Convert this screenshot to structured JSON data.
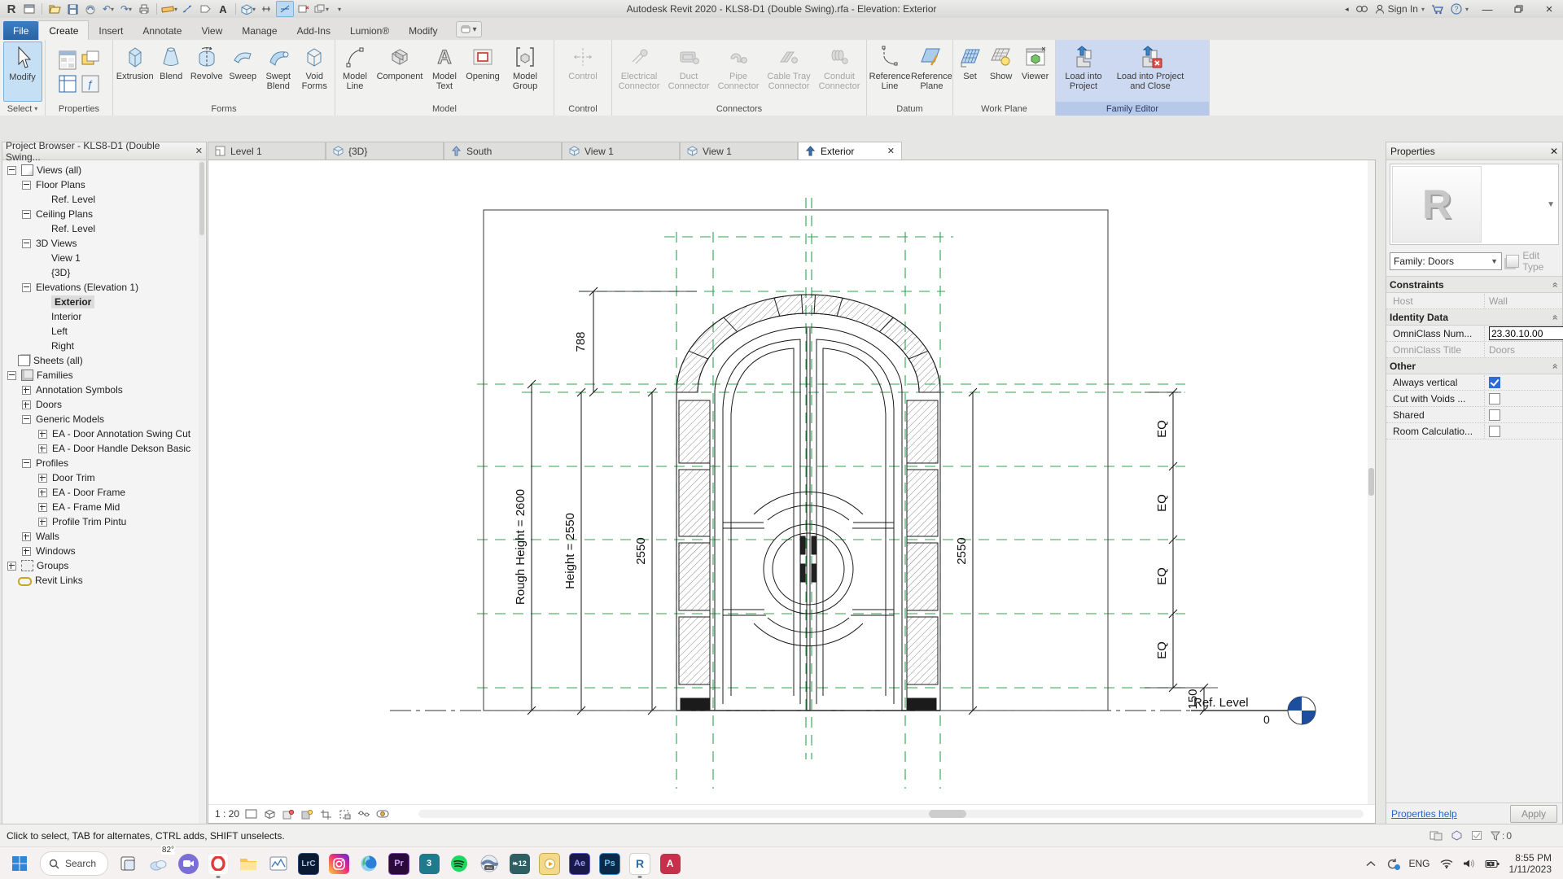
{
  "window": {
    "title": "Autodesk Revit 2020 - KLS8-D1 (Double Swing).rfa - Elevation: Exterior",
    "sign_in": "Sign In"
  },
  "ribbon": {
    "tabs": [
      "File",
      "Create",
      "Insert",
      "Annotate",
      "View",
      "Manage",
      "Add-Ins",
      "Lumion®",
      "Modify"
    ],
    "groups": {
      "select": "Select",
      "properties": "Properties",
      "forms": "Forms",
      "model": "Model",
      "control": "Control",
      "connectors": "Connectors",
      "datum": "Datum",
      "work_plane": "Work Plane",
      "family_editor": "Family Editor"
    },
    "select": {
      "modify": "Modify"
    },
    "forms": {
      "extrusion": "Extrusion",
      "blend": "Blend",
      "revolve": "Revolve",
      "sweep": "Sweep",
      "swept_blend": "Swept Blend",
      "void_forms": "Void Forms"
    },
    "model": {
      "model_line": "Model Line",
      "component": "Component",
      "model_text": "Model Text",
      "opening": "Opening",
      "model_group": "Model Group"
    },
    "control": {
      "control": "Control"
    },
    "connectors": {
      "electrical": "Electrical Connector",
      "duct": "Duct Connector",
      "pipe": "Pipe Connector",
      "cable_tray": "Cable Tray Connector",
      "conduit": "Conduit Connector"
    },
    "datum": {
      "reference_line": "Reference Line",
      "reference_plane": "Reference Plane"
    },
    "work_plane": {
      "set": "Set",
      "show": "Show",
      "viewer": "Viewer"
    },
    "family_editor": {
      "load": "Load into Project",
      "load_close": "Load into Project and Close"
    }
  },
  "browser": {
    "title": "Project Browser - KLS8-D1 (Double Swing...",
    "items": [
      "Views (all)",
      "Floor Plans",
      "Ref. Level",
      "Ceiling Plans",
      "Ref. Level",
      "3D Views",
      "View 1",
      "{3D}",
      "Elevations (Elevation 1)",
      "Exterior",
      "Interior",
      "Left",
      "Right",
      "Sheets (all)",
      "Families",
      "Annotation Symbols",
      "Doors",
      "Generic Models",
      "EA - Door Annotation Swing Cut",
      "EA - Door Handle Dekson Basic",
      "Profiles",
      "Door Trim",
      "EA - Door Frame",
      "EA - Frame Mid",
      "Profile Trim Pintu",
      "Walls",
      "Windows",
      "Groups",
      "Revit Links"
    ]
  },
  "view_tabs": [
    "Level 1",
    "{3D}",
    "South",
    "View 1",
    "View 1",
    "Exterior"
  ],
  "properties_panel": {
    "header": "Properties",
    "type_selector": "Family: Doors",
    "edit_type": "Edit Type",
    "sections": {
      "constraints": "Constraints",
      "identity": "Identity Data",
      "other": "Other"
    },
    "rows": {
      "host_label": "Host",
      "host_value": "Wall",
      "omniclass_num_label": "OmniClass Num...",
      "omniclass_num_value": "23.30.10.00",
      "omniclass_title_label": "OmniClass Title",
      "omniclass_title_value": "Doors",
      "always_vertical": "Always vertical",
      "cut_with_voids": "Cut with Voids ...",
      "shared": "Shared",
      "room_calc": "Room Calculatio..."
    },
    "footer": {
      "help": "Properties help",
      "apply": "Apply"
    }
  },
  "drawing": {
    "labels": {
      "arc_height": "788",
      "rough_height": "Rough Height = 2600",
      "height": "Height = 2550",
      "left_2550": "2550",
      "right_2550": "2550",
      "eq": "EQ",
      "dim_150": "150",
      "ref_level": "Ref. Level",
      "level_value": "0"
    },
    "scale": "1 : 20",
    "colors": {
      "reference_plane": "#2ca44e",
      "level_blue": "#1d4e9e"
    }
  },
  "status_bar": {
    "hint": "Click to select, TAB for alternates, CTRL adds, SHIFT unselects.",
    "filter_count": "0"
  },
  "taskbar": {
    "search": "Search",
    "weather": "82°",
    "lang": "ENG",
    "time": "8:55 PM",
    "date": "1/11/2023"
  }
}
